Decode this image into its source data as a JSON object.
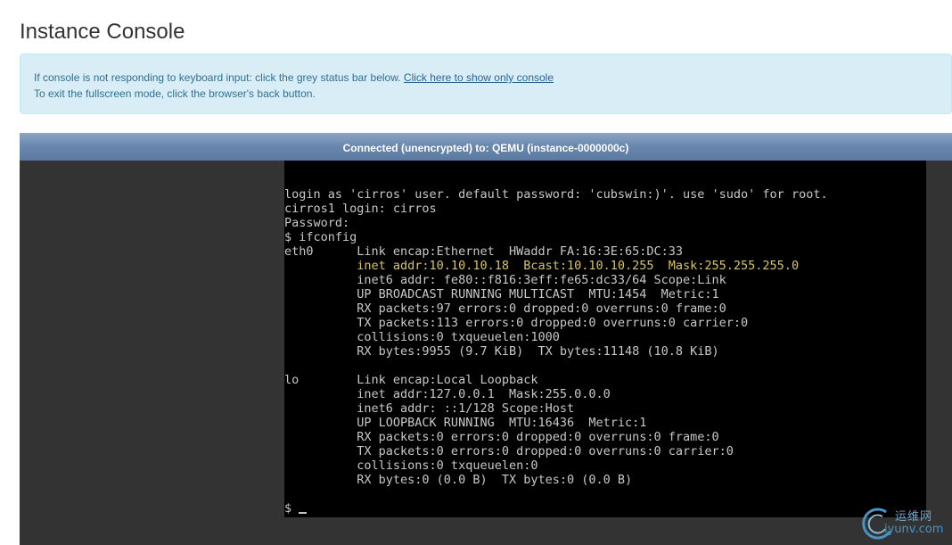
{
  "page": {
    "title": "Instance Console"
  },
  "info": {
    "line1": "If console is not responding to keyboard input: click the grey status bar below.",
    "link": "Click here to show only console",
    "line2": "To exit the fullscreen mode, click the browser's back button."
  },
  "console": {
    "status": "Connected (unencrypted) to: QEMU (instance-0000000c)",
    "lines": [
      "login as 'cirros' user. default password: 'cubswin:)'. use 'sudo' for root.",
      "cirros1 login: cirros",
      "Password:",
      "$ ifconfig",
      "eth0      Link encap:Ethernet  HWaddr FA:16:3E:65:DC:33",
      "          inet addr:10.10.10.18  Bcast:10.10.10.255  Mask:255.255.255.0",
      "          inet6 addr: fe80::f816:3eff:fe65:dc33/64 Scope:Link",
      "          UP BROADCAST RUNNING MULTICAST  MTU:1454  Metric:1",
      "          RX packets:97 errors:0 dropped:0 overruns:0 frame:0",
      "          TX packets:113 errors:0 dropped:0 overruns:0 carrier:0",
      "          collisions:0 txqueuelen:1000",
      "          RX bytes:9955 (9.7 KiB)  TX bytes:11148 (10.8 KiB)",
      "",
      "lo        Link encap:Local Loopback",
      "          inet addr:127.0.0.1  Mask:255.0.0.0",
      "          inet6 addr: ::1/128 Scope:Host",
      "          UP LOOPBACK RUNNING  MTU:16436  Metric:1",
      "          RX packets:0 errors:0 dropped:0 overruns:0 frame:0",
      "          TX packets:0 errors:0 dropped:0 overruns:0 carrier:0",
      "          collisions:0 txqueuelen:0",
      "          RX bytes:0 (0.0 B)  TX bytes:0 (0.0 B)",
      ""
    ],
    "highlight_line": 5,
    "prompt": "$ "
  },
  "watermark": {
    "cn": "运维网",
    "url": "iyunv.com"
  },
  "colors": {
    "info_bg": "#d9edf7",
    "info_text": "#31708f",
    "status_bar": "#6a88ae",
    "terminal_bg": "#000000",
    "terminal_text": "#c8c8c8",
    "terminal_highlight": "#d4c46a",
    "console_frame": "#333333"
  }
}
